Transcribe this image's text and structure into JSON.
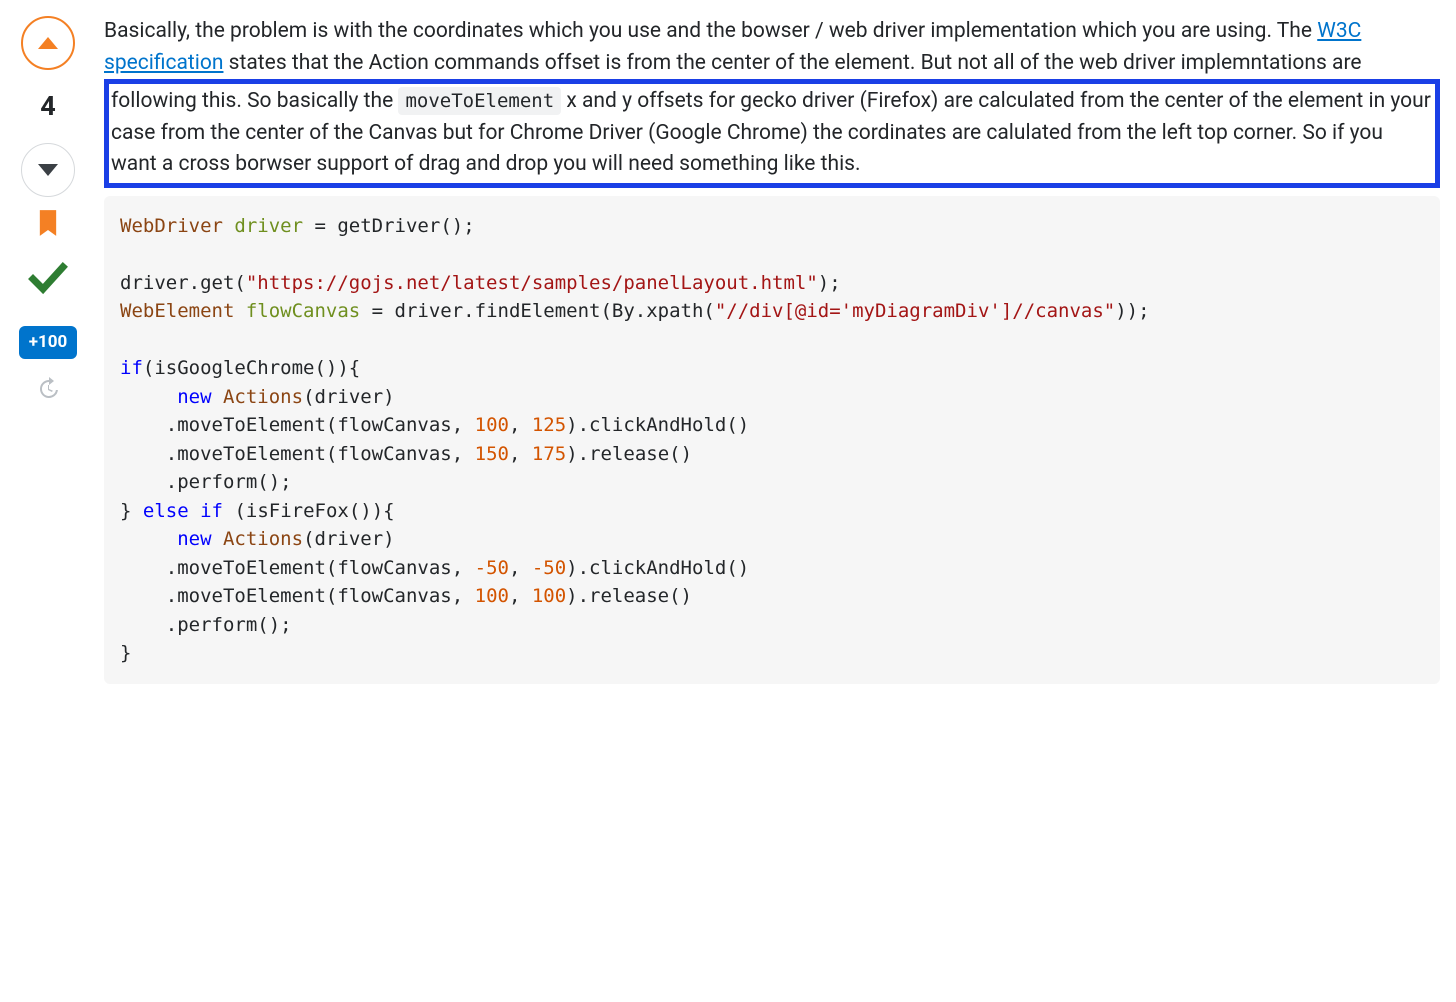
{
  "vote": {
    "count": "4",
    "bounty": "+100"
  },
  "answer": {
    "para1_before_link": "Basically, the problem is with the coordinates which you use and the bowser / web driver implementation which you are using. The ",
    "link_text": "W3C specification",
    "para1_after_link_before_box": " states that the Action commands offset is from the center of the element. But not all of the web driver implemntations are ",
    "boxed_before_code": "following this. So basically the ",
    "inline_code": "moveToElement",
    "boxed_after_code": " x and y offsets for gecko driver (Firefox) are calculated from the center of the element in your case from the center of the Canvas but for Chrome Driver (Google Chrome) the cordinates are calulated from the left top corner. So if you want a cross borwser support of drag and drop you will need something like this."
  },
  "code": {
    "l1_type": "WebDriver",
    "l1_var": "driver",
    "l1_rest": " = getDriver();",
    "l3_pre": "driver.get(",
    "l3_str": "\"https://gojs.net/latest/samples/panelLayout.html\"",
    "l3_post": ");",
    "l4_type": "WebElement",
    "l4_var": "flowCanvas",
    "l4_mid": " = driver.findElement(By.xpath(",
    "l4_str": "\"//div[@id='myDiagramDiv']//canvas\"",
    "l4_post": "));",
    "l6_kw": "if",
    "l6_rest": "(isGoogleChrome()){",
    "l7_indent": "     ",
    "l7_new": "new",
    "l7_cls": "Actions",
    "l7_rest": "(driver)",
    "l8_indent": "    ",
    "l8_pre": ".moveToElement(flowCanvas, ",
    "l8_n1": "100",
    "l8_mid": ", ",
    "l8_n2": "125",
    "l8_post": ").clickAndHold()",
    "l9_pre": ".moveToElement(flowCanvas, ",
    "l9_n1": "150",
    "l9_mid": ", ",
    "l9_n2": "175",
    "l9_post": ").release()",
    "l10": ".perform();",
    "l11_pre": "} ",
    "l11_kw1": "else",
    "l11_sp": " ",
    "l11_kw2": "if",
    "l11_rest": " (isFireFox()){",
    "l13_pre": ".moveToElement(flowCanvas, ",
    "l13_n1": "-50",
    "l13_mid": ", ",
    "l13_n2": "-50",
    "l13_post": ").clickAndHold()",
    "l14_pre": ".moveToElement(flowCanvas, ",
    "l14_n1": "100",
    "l14_mid": ", ",
    "l14_n2": "100",
    "l14_post": ").release()",
    "l16": "}"
  }
}
